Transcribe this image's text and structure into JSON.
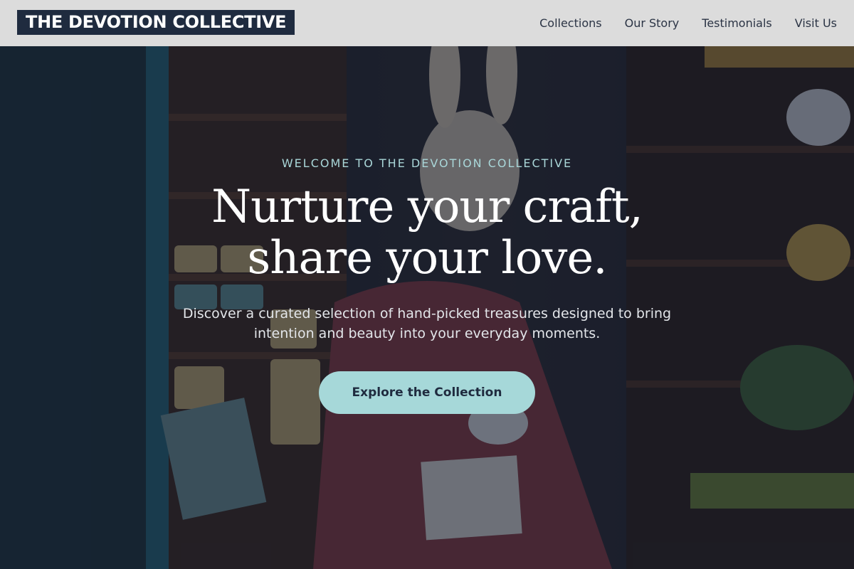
{
  "brand": {
    "name": "THE DEVOTION COLLECTIVE"
  },
  "nav": {
    "items": [
      {
        "label": "Collections"
      },
      {
        "label": "Our Story"
      },
      {
        "label": "Testimonials"
      },
      {
        "label": "Visit Us"
      }
    ]
  },
  "hero": {
    "eyebrow": "WELCOME TO THE DEVOTION COLLECTIVE",
    "headline": "Nurture your craft, share your love.",
    "subtitle": "Discover a curated selection of hand-picked treasures designed to bring intention and beauty into your everyday moments.",
    "cta_label": "Explore the Collection"
  },
  "colors": {
    "brand_navy": "#1f2b3f",
    "accent_teal": "#a6d8d9",
    "eyebrow_teal": "#a9d6d8",
    "header_bg": "#dcdcdc"
  }
}
